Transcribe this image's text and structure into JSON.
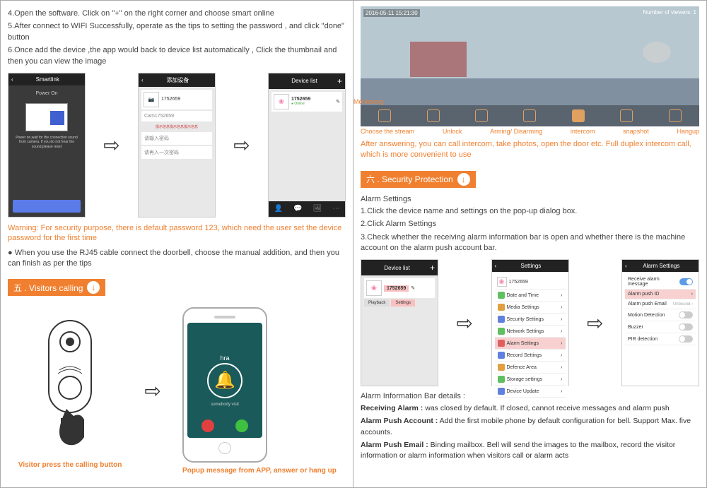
{
  "left": {
    "step4": "4.Open the software. Click on \"+\" on the right corner and choose smart online",
    "step5": "5.After connect to WIFI Successfully, operate as the tips to setting the password , and click \"done\" button",
    "step6": "6.Once add the device ,the app would back to device list automatically , Click the thumbnail and then you can view the image",
    "screens": {
      "s1_title": "Smartlink",
      "s1_power": "Power On",
      "s1_tip": "Power on,wait for the connection sound from camera. If you do not hear the sound,please reset",
      "s2_title": "添加设备",
      "s2_id": "1752659",
      "s2_name": "Cam1752659",
      "s3_title": "Device list",
      "s3_id": "1752659"
    },
    "warning": "Warning: For security purpose, there is default password 123, which need the user set the device password for the first time",
    "bullet1": "● When you use the RJ45 cable connect the doorbell, choose the manual addition, and then you can finish as per the tips",
    "section5": "五 . Visitors calling",
    "caller_name": "hra",
    "caller_sub": "somebody visit",
    "caption_left": "Visitor press the calling button",
    "caption_right": "Popup message from APP, answer or hang up"
  },
  "right": {
    "camera": {
      "timestamp": "2016-05-11 15:21:30",
      "viewers": "Number of viewers: 1",
      "labels": {
        "monitoring": "Monitoring",
        "stream": "Choose the stream",
        "unlock": "Unlock",
        "arming": "Arming/ Disarming",
        "intercom": "intercom",
        "snapshot": "snapshot",
        "hangup": "Hangup"
      }
    },
    "after_answer": "After answering, you can call intercom, take photos, open the door etc. Full duplex intercom call, which is more convenient to use",
    "section6": "六 . Security Protection",
    "alarm_title": "Alarm Settings",
    "alarm_step1": "1.Click the device name and settings on the pop-up dialog box.",
    "alarm_step2": "2.Click Alarm Settings",
    "alarm_step3": "3.Check whether the receiving alarm information bar is open and whether there is the machine account on the alarm push account bar.",
    "screens2": {
      "s1_title": "Device list",
      "s1_id": "1752659",
      "s2_title": "Settings",
      "s2_items": [
        "Date and Time",
        "Media Settings",
        "Security Settings",
        "Network Settings",
        "Alarm Settings",
        "Record Settings",
        "Defence Area",
        "Storage settings",
        "Device Update"
      ],
      "s3_title": "Alarm Settings",
      "s3_items": [
        "Receive alarm message",
        "Alarm push ID",
        "Alarm push Email",
        "Motion Detection",
        "Buzzer",
        "PIR detection"
      ]
    },
    "details_title": "Alarm Information Bar details :",
    "d1_label": "Receiving Alarm :",
    "d1_text": " was closed by default. If closed, cannot receive messages and alarm push",
    "d2_label": "Alarm Push Account :",
    "d2_text": " Add the first mobile phone by default configuration for bell. Support Max. five accounts.",
    "d3_label": "Alarm Push Email :",
    "d3_text": " Binding mailbox. Bell will send the images to the mailbox, record the visitor information or alarm information when visitors call or alarm acts"
  }
}
